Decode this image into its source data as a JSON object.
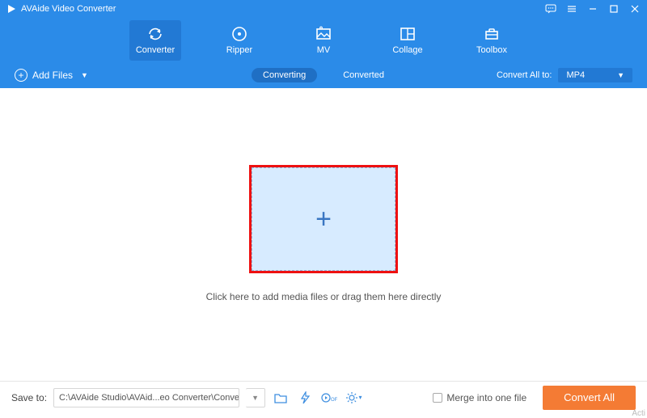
{
  "app": {
    "title": "AVAide Video Converter"
  },
  "window_buttons": [
    "feedback-icon",
    "menu-icon",
    "minimize-icon",
    "maximize-icon",
    "close-icon"
  ],
  "nav": {
    "items": [
      {
        "label": "Converter",
        "icon": "convert-icon",
        "active": true
      },
      {
        "label": "Ripper",
        "icon": "disc-icon",
        "active": false
      },
      {
        "label": "MV",
        "icon": "image-icon",
        "active": false
      },
      {
        "label": "Collage",
        "icon": "collage-icon",
        "active": false
      },
      {
        "label": "Toolbox",
        "icon": "toolbox-icon",
        "active": false
      }
    ]
  },
  "subbar": {
    "add_files_label": "Add Files",
    "tabs": {
      "converting": "Converting",
      "converted": "Converted",
      "active": "converting"
    },
    "convert_all_to_label": "Convert All to:",
    "format": "MP4"
  },
  "main": {
    "dropzone_message": "Click here to add media files or drag them here directly"
  },
  "footer": {
    "save_to_label": "Save to:",
    "save_path": "C:\\AVAide Studio\\AVAid...eo Converter\\Converted",
    "icons": [
      "open-folder-icon",
      "gpu-accel-icon",
      "high-speed-off-icon",
      "settings-gear-icon"
    ],
    "merge_label": "Merge into one file",
    "merge_checked": false,
    "convert_button_label": "Convert All"
  },
  "watermark": "Acti"
}
